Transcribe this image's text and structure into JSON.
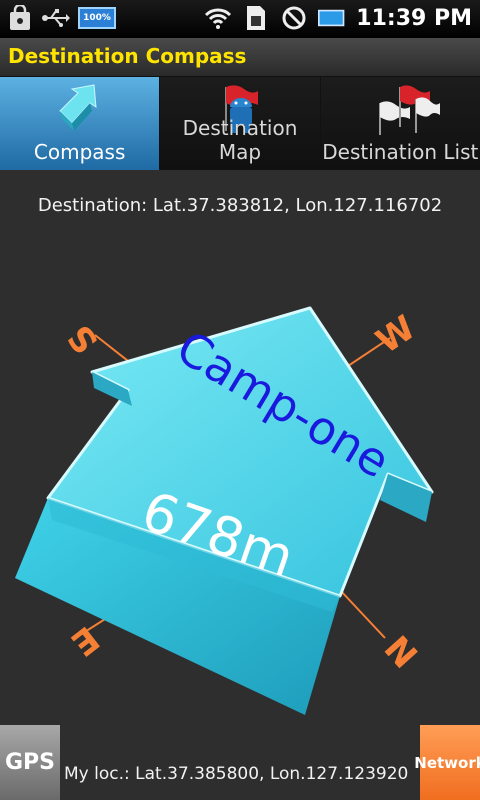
{
  "status_bar": {
    "battery_label": "100%",
    "time": "11:39 PM"
  },
  "app": {
    "title": "Destination Compass"
  },
  "tabs": [
    {
      "label": "Compass",
      "icon": "compass-arrow-icon",
      "active": true
    },
    {
      "label": "Destination Map",
      "icon": "map-flag-android-icon",
      "active": false
    },
    {
      "label": "Destination List",
      "icon": "flags-list-icon",
      "active": false
    }
  ],
  "destination": {
    "text": "Destination: Lat.37.383812, Lon.127.116702"
  },
  "compass": {
    "destination_name": "Camp-one",
    "distance": "678m",
    "labels": {
      "north": "N",
      "south": "S",
      "east": "E",
      "west": "W"
    },
    "colors": {
      "arrow": "#4fd6ec",
      "labels": "#f57f35",
      "name_text": "#1a1adf",
      "distance_text": "#ffffff"
    }
  },
  "bottom": {
    "gps_label": "GPS",
    "network_label": "Network",
    "my_location": "My loc.: Lat.37.385800, Lon.127.123920"
  }
}
